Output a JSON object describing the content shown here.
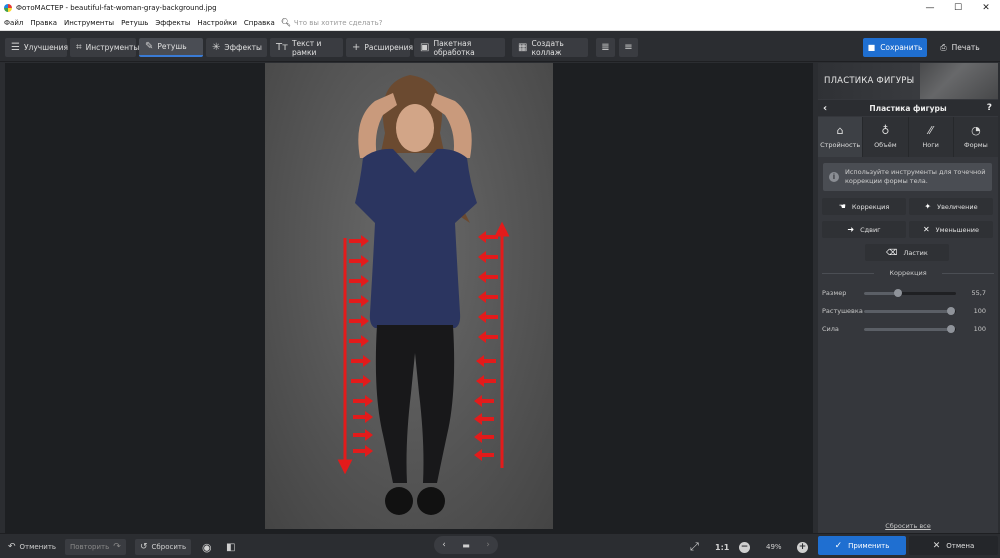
{
  "window": {
    "app_name": "ФотоМАСТЕР",
    "title": "ФотоМАСТЕР - beautiful-fat-woman-gray-background.jpg",
    "controls": [
      "—",
      "☐",
      "✕"
    ]
  },
  "menu": {
    "items": [
      "Файл",
      "Правка",
      "Инструменты",
      "Ретушь",
      "Эффекты",
      "Настройки",
      "Справка"
    ],
    "search_placeholder": "Что вы хотите сделать?"
  },
  "toolbar": {
    "tabs": [
      {
        "label": "Улучшения",
        "icon": "sliders-icon"
      },
      {
        "label": "Инструменты",
        "icon": "crop-icon"
      },
      {
        "label": "Ретушь",
        "icon": "brush-icon",
        "active": true
      },
      {
        "label": "Эффекты",
        "icon": "magic-wand-icon"
      },
      {
        "label": "Текст и рамки",
        "icon": "text-icon"
      },
      {
        "label": "Расширения",
        "icon": "plus-icon"
      }
    ],
    "batch_label": "Пакетная обработка",
    "collage_label": "Создать коллаж",
    "save_label": "Сохранить",
    "print_label": "Печать"
  },
  "panel": {
    "header": "ПЛАСТИКА ФИГУРЫ",
    "subheader": "Пластика фигуры",
    "help": "?",
    "tabs": [
      {
        "label": "Стройность",
        "icon": "body-slim-icon"
      },
      {
        "label": "Объём",
        "icon": "volume-icon"
      },
      {
        "label": "Ноги",
        "icon": "legs-icon"
      },
      {
        "label": "Формы",
        "icon": "shapes-icon"
      }
    ],
    "info_text": "Используйте инструменты для точечной коррекции формы тела.",
    "tools": {
      "correction": "Коррекция",
      "enlarge": "Увеличение",
      "shift": "Сдвиг",
      "shrink": "Уменьшение",
      "eraser": "Ластик"
    },
    "section_title": "Коррекция",
    "sliders": [
      {
        "label": "Размер",
        "value": "55,7",
        "fraction": 0.37
      },
      {
        "label": "Растушевка",
        "value": "100",
        "fraction": 0.95
      },
      {
        "label": "Сила",
        "value": "100",
        "fraction": 0.95
      }
    ],
    "reset_all": "Сбросить все"
  },
  "bottom": {
    "undo_label": "Отменить",
    "redo_label": "Повторить",
    "reset_label": "Сбросить",
    "zoom_ratio": "1:1",
    "zoom_percent": "49%",
    "apply_label": "Применить",
    "cancel_label": "Отмена"
  },
  "colors": {
    "accent": "#1f6fd1",
    "arrow_red": "#e31b1b",
    "panel_bg": "#35373c",
    "canvas_bg": "#1d1f22"
  }
}
